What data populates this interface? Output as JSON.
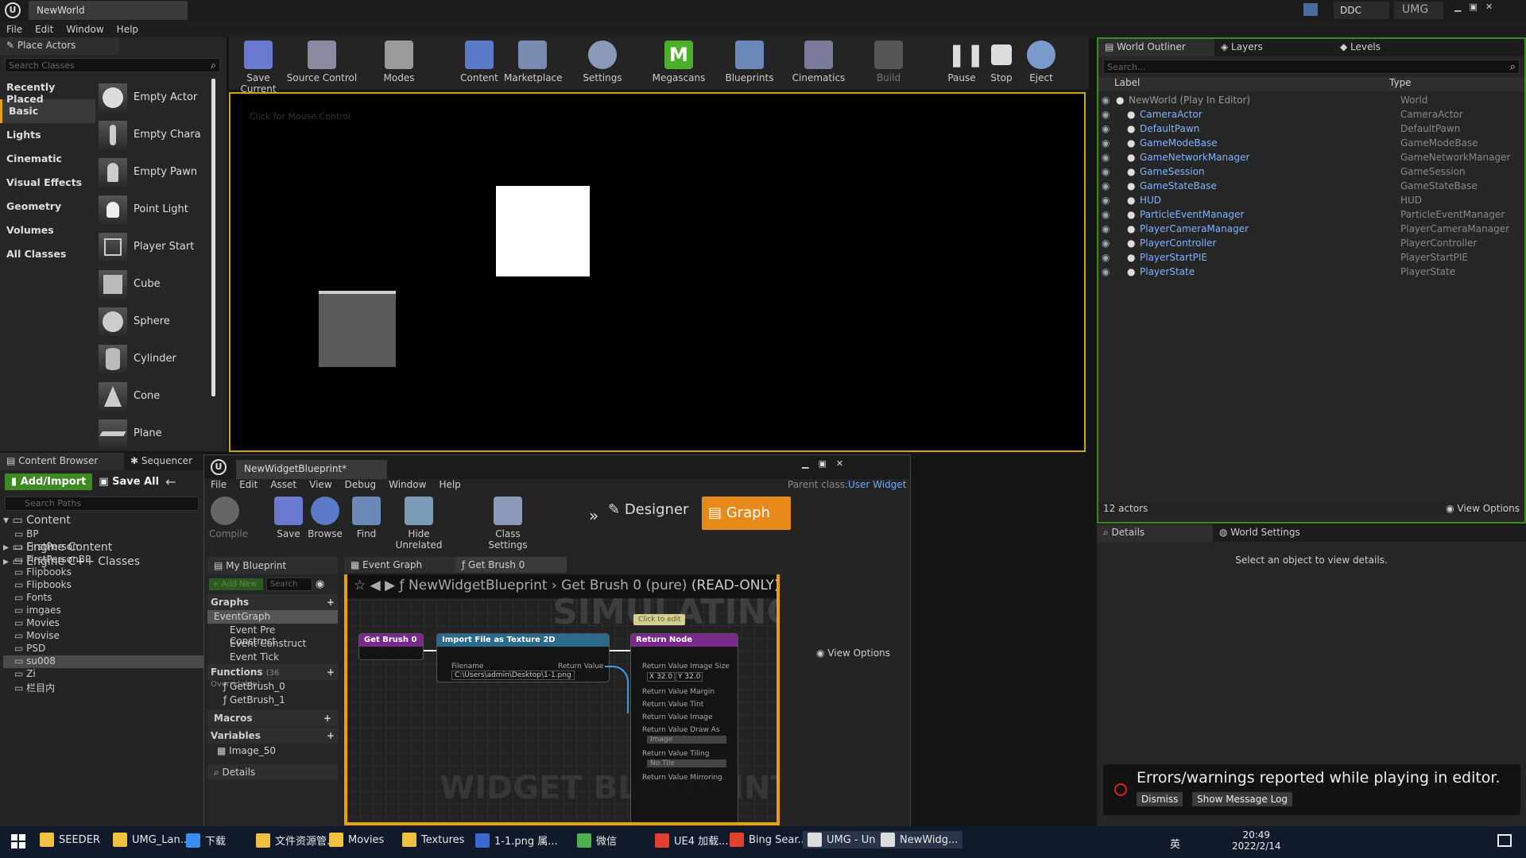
{
  "window": {
    "tab_title": "NewWorld",
    "ddc": "DDC",
    "umg": "UMG"
  },
  "menu": [
    "File",
    "Edit",
    "Window",
    "Help"
  ],
  "place": {
    "tab": "Place Actors",
    "search_placeholder": "Search Classes",
    "categories": [
      "Recently Placed",
      "Basic",
      "Lights",
      "Cinematic",
      "Visual Effects",
      "Geometry",
      "Volumes",
      "All Classes"
    ],
    "items": [
      "Empty Actor",
      "Empty Chara",
      "Empty Pawn",
      "Point Light",
      "Player Start",
      "Cube",
      "Sphere",
      "Cylinder",
      "Cone",
      "Plane"
    ]
  },
  "toolbar": [
    {
      "label": "Save Current"
    },
    {
      "label": "Source Control"
    },
    {
      "label": "Modes"
    },
    {
      "label": "Content"
    },
    {
      "label": "Marketplace"
    },
    {
      "label": "Settings"
    },
    {
      "label": "Megascans"
    },
    {
      "label": "Blueprints"
    },
    {
      "label": "Cinematics"
    },
    {
      "label": "Build"
    },
    {
      "label": "Pause"
    },
    {
      "label": "Stop"
    },
    {
      "label": "Eject"
    }
  ],
  "viewport": {
    "hint": "Click for Mouse Control"
  },
  "outliner": {
    "tabs": [
      "World Outliner",
      "Layers",
      "Levels"
    ],
    "search_placeholder": "Search...",
    "col_label": "Label",
    "col_type": "Type",
    "rows": [
      {
        "label": "NewWorld (Play In Editor)",
        "type": "World"
      },
      {
        "label": "CameraActor",
        "type": "CameraActor"
      },
      {
        "label": "DefaultPawn",
        "type": "DefaultPawn"
      },
      {
        "label": "GameModeBase",
        "type": "GameModeBase"
      },
      {
        "label": "GameNetworkManager",
        "type": "GameNetworkManager"
      },
      {
        "label": "GameSession",
        "type": "GameSession"
      },
      {
        "label": "GameStateBase",
        "type": "GameStateBase"
      },
      {
        "label": "HUD",
        "type": "HUD"
      },
      {
        "label": "ParticleEventManager",
        "type": "ParticleEventManager"
      },
      {
        "label": "PlayerCameraManager",
        "type": "PlayerCameraManager"
      },
      {
        "label": "PlayerController",
        "type": "PlayerController"
      },
      {
        "label": "PlayerStartPIE",
        "type": "PlayerStartPIE"
      },
      {
        "label": "PlayerState",
        "type": "PlayerState"
      }
    ],
    "count": "12 actors",
    "view_options": "View Options"
  },
  "details": {
    "tabs": [
      "Details",
      "World Settings"
    ],
    "empty": "Select an object to view details."
  },
  "errors": {
    "text": "Errors/warnings reported while playing in editor.",
    "dismiss": "Dismiss",
    "show_log": "Show Message Log"
  },
  "content": {
    "tabs": [
      "Content Browser",
      "Sequencer"
    ],
    "add": "Add/Import",
    "save_all": "Save All",
    "search_placeholder": "Search Paths",
    "root": "Content",
    "folders": [
      "BP",
      "FirstPerson",
      "FirstPersonBP",
      "Flipbooks",
      "Flipbooks",
      "Fonts",
      "imgaes",
      "Movies",
      "Movise",
      "PSD",
      "su008",
      "Zi",
      "栏目内"
    ],
    "engine": "Engine Content",
    "cpp": "Engine C++ Classes"
  },
  "bp": {
    "tab": "NewWidgetBlueprint*",
    "parent_label": "Parent class:",
    "parent_value": "User Widget",
    "menu": [
      "File",
      "Edit",
      "Asset",
      "View",
      "Debug",
      "Window",
      "Help"
    ],
    "tools": [
      "Compile",
      "Save",
      "Browse",
      "Find",
      "Hide Unrelated",
      "Class Settings"
    ],
    "designer": "Designer",
    "graph": "Graph",
    "mybp": "My Blueprint",
    "add_new": "+ Add New",
    "search": "Search",
    "graphs_label": "Graphs",
    "event_graph": "EventGraph",
    "events": [
      "Event Pre Construct",
      "Event Construct",
      "Event Tick"
    ],
    "functions_label": "Functions",
    "functions_count": "(36 Overridable)",
    "functions": [
      "GetBrush_0",
      "GetBrush_1"
    ],
    "macros": "Macros",
    "variables": "Variables",
    "var1": "Image_50",
    "details": "Details",
    "graph_tabs": [
      "Event Graph",
      "Get Brush 0"
    ],
    "breadcrumb": "NewWidgetBlueprint",
    "crumb_fn": "Get Brush 0 (pure)",
    "readonly": "(READ-ONLY)",
    "simulating": "SIMULATING",
    "watermark": "WIDGET BLUEPRINT",
    "comment": "Click to edit",
    "node1": "Get Brush 0",
    "node2": "Import File as Texture 2D",
    "node3": "Return Node",
    "filename_label": "Filename",
    "filename": "C:\\Users\\admin\\Desktop\\1-1.png",
    "return_value": "Return Value",
    "rn_size": "Return Value Image Size",
    "x": "32.0",
    "y": "32.0",
    "x_label": "X",
    "y_label": "Y",
    "rn_margin": "Return Value Margin",
    "rn_tint": "Return Value Tint",
    "rn_image": "Return Value Image",
    "rn_draw": "Return Value Draw As",
    "draw_val": "Image",
    "rn_tiling": "Return Value Tiling",
    "tiling_val": "No Tile",
    "rn_mirror": "Return Value Mirroring",
    "view_options": "View Options"
  },
  "taskbar": {
    "items": [
      "SEEDER",
      "UMG_Lan...",
      "下载",
      "文件资源管...",
      "Movies",
      "Textures",
      "1-1.png 属...",
      "微信",
      "UE4 加载...",
      "Bing Sear...",
      "UMG - Un...",
      "NewWidg..."
    ],
    "time": "20:49",
    "date": "2022/2/14",
    "ime": "英"
  }
}
